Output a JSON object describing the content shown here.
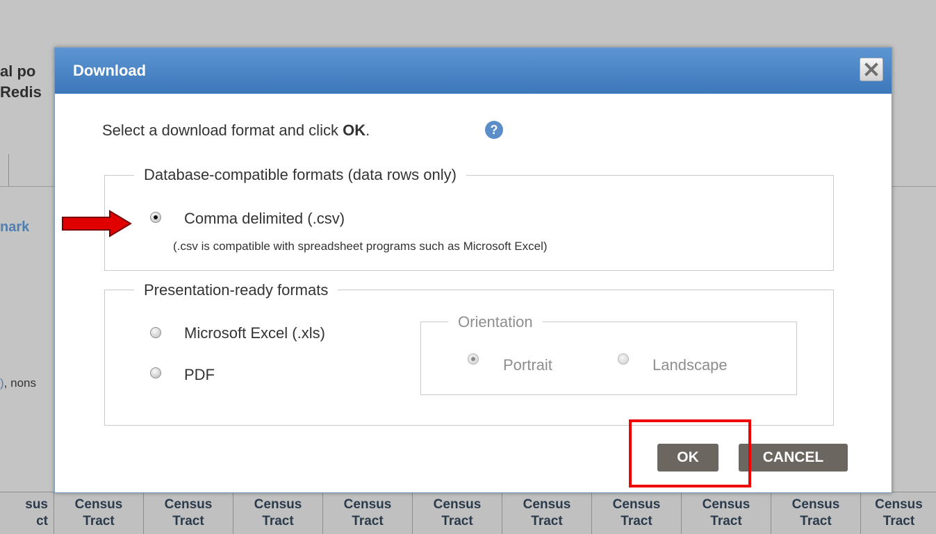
{
  "background": {
    "title_fragment_line1": "al po",
    "title_fragment_line2": "Redis",
    "link_fragment": "nark",
    "note_link_fragment": "",
    "note_fragment": ", nons",
    "table_header": {
      "first_cell_line1": "sus",
      "first_cell_line2": "ct",
      "cell_line1": "Census",
      "cell_line2": "Tract",
      "column_count": 10
    }
  },
  "dialog": {
    "title": "Download",
    "instruction_pre": "Select a download format and click ",
    "instruction_bold": "OK",
    "instruction_post": ".",
    "database_group": {
      "legend": "Database-compatible formats (data rows only)",
      "options": [
        {
          "label": "Comma delimited (.csv)",
          "checked": true,
          "note": "(.csv is compatible with spreadsheet programs such as Microsoft Excel)"
        }
      ]
    },
    "presentation_group": {
      "legend": "Presentation-ready formats",
      "options": [
        {
          "label": "Microsoft Excel (.xls)",
          "checked": false
        },
        {
          "label": "PDF",
          "checked": false
        }
      ],
      "orientation": {
        "legend": "Orientation",
        "options": [
          {
            "label": "Portrait",
            "checked": true,
            "disabled": true
          },
          {
            "label": "Landscape",
            "checked": false,
            "disabled": true
          }
        ]
      }
    },
    "buttons": {
      "ok": "OK",
      "cancel": "CANCEL"
    }
  },
  "annotations": {
    "arrow_color": "#e00000",
    "highlight_color": "#f00000"
  }
}
